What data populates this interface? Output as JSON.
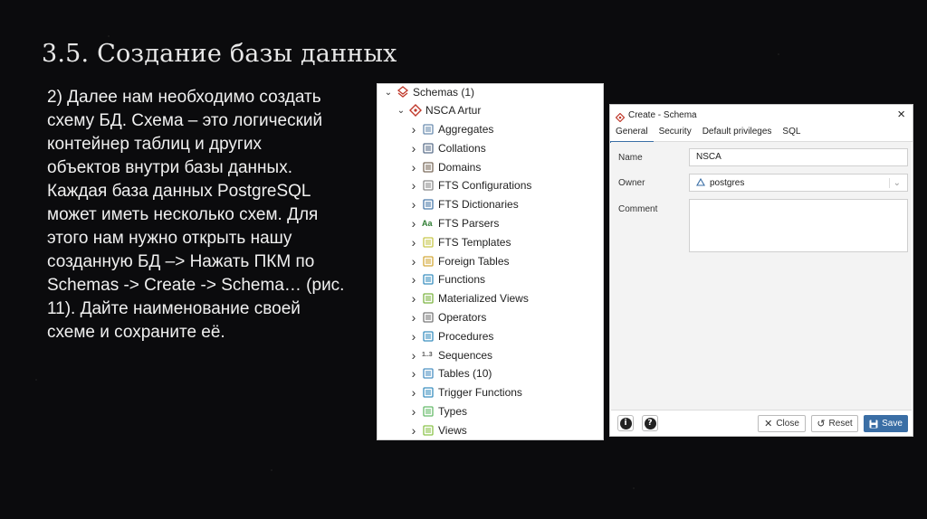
{
  "slide": {
    "title": "3.5. Создание базы данных",
    "body_lines": [
      "2) Далее нам необходимо создать",
      "схему БД. Схема – это логический",
      "контейнер таблиц и других",
      "объектов внутри базы данных.",
      "Каждая база данных PostgreSQL",
      "может иметь несколько схем. Для",
      "этого нам нужно открыть нашу",
      "созданную БД –> Нажать ПКМ по",
      "Schemas -> Create -> Schema… (рис.",
      "11). Дайте наименование своей",
      "схеме и сохраните её."
    ]
  },
  "tree": {
    "schemas_label": "Schemas (1)",
    "schema_label": "NSCA Artur",
    "items": [
      {
        "label": "Aggregates",
        "icon": "aggregates-icon"
      },
      {
        "label": "Collations",
        "icon": "collations-icon"
      },
      {
        "label": "Domains",
        "icon": "domains-icon"
      },
      {
        "label": "FTS Configurations",
        "icon": "fts-configurations-icon"
      },
      {
        "label": "FTS Dictionaries",
        "icon": "fts-dictionaries-icon"
      },
      {
        "label": "FTS Parsers",
        "icon": "fts-parsers-icon",
        "glyph": "Aa"
      },
      {
        "label": "FTS Templates",
        "icon": "fts-templates-icon"
      },
      {
        "label": "Foreign Tables",
        "icon": "foreign-tables-icon"
      },
      {
        "label": "Functions",
        "icon": "functions-icon"
      },
      {
        "label": "Materialized Views",
        "icon": "materialized-views-icon"
      },
      {
        "label": "Operators",
        "icon": "operators-icon"
      },
      {
        "label": "Procedures",
        "icon": "procedures-icon"
      },
      {
        "label": "Sequences",
        "icon": "sequences-icon",
        "glyph": "1..3"
      },
      {
        "label": "Tables (10)",
        "icon": "tables-icon"
      },
      {
        "label": "Trigger Functions",
        "icon": "trigger-functions-icon"
      },
      {
        "label": "Types",
        "icon": "types-icon"
      },
      {
        "label": "Views",
        "icon": "views-icon"
      }
    ]
  },
  "dialog": {
    "title": "Create - Schema",
    "close": "×",
    "tabs": [
      "General",
      "Security",
      "Default privileges",
      "SQL"
    ],
    "active_tab": "General",
    "fields": {
      "name_label": "Name",
      "name_value": "NSCA",
      "owner_label": "Owner",
      "owner_value": "postgres",
      "comment_label": "Comment",
      "comment_value": ""
    },
    "buttons": {
      "info": "i",
      "help": "?",
      "close_label": "Close",
      "reset_label": "Reset",
      "save_label": "Save"
    }
  },
  "colors": {
    "save_button": "#3a6ea5",
    "schema_icon": "#c0392b",
    "tab_active": "#3a6ea5"
  }
}
